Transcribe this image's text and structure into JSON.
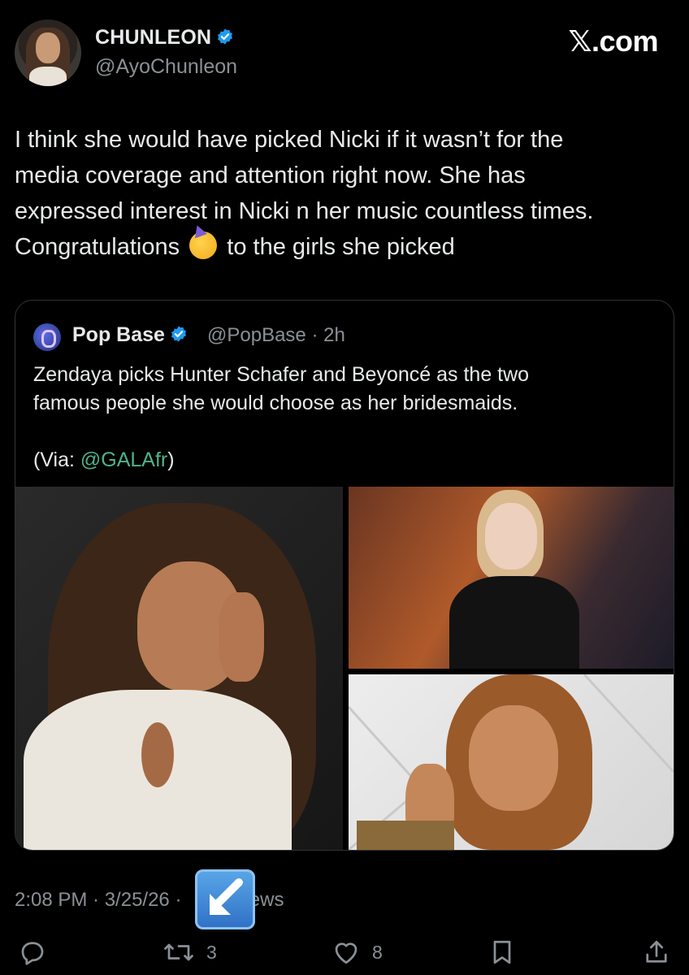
{
  "author": {
    "name": "CHUNLEON",
    "handle": "@AyoChunleon",
    "verified": true
  },
  "brand": "𝕏.com",
  "tweet": {
    "lines": [
      "I think she would have picked Nicki if it wasn’t for the",
      "media coverage and attention right now. She has",
      "expressed interest in Nicki n her music countless times.",
      "Congratulations",
      "to the girls she picked"
    ],
    "emoji": "partying-face-emoji"
  },
  "quote": {
    "name": "Pop Base",
    "handle": "@PopBase · 2h",
    "verified": true,
    "lines": [
      "Zendaya picks Hunter Schafer and Beyoncé as the two",
      "famous people she would choose as her bridesmaids."
    ],
    "via_prefix": "(Via: ",
    "via_link": "@GALAfr",
    "via_suffix": ")",
    "images": [
      {
        "name": "zendaya-photo",
        "bg": "#202020"
      },
      {
        "name": "hunter-schafer-photo",
        "bg": "#7a3d22"
      },
      {
        "name": "beyonce-photo",
        "bg": "#e3e3e3"
      }
    ]
  },
  "meta": {
    "timestamp": "2:08 PM · 3/25/26 ·",
    "views": "iews"
  },
  "actions": {
    "reply": {
      "icon": "reply-icon",
      "count": ""
    },
    "repost": {
      "icon": "repost-icon",
      "count": "3"
    },
    "like": {
      "icon": "heart-icon",
      "count": "8"
    },
    "bookmark": {
      "icon": "bookmark-icon",
      "count": ""
    },
    "share": {
      "icon": "share-icon",
      "count": ""
    }
  },
  "colors": {
    "background": "#000000",
    "text": "#e7e9ea",
    "muted": "#8b9096",
    "verified": "#1d9bf0",
    "link": "#4fb38a"
  }
}
